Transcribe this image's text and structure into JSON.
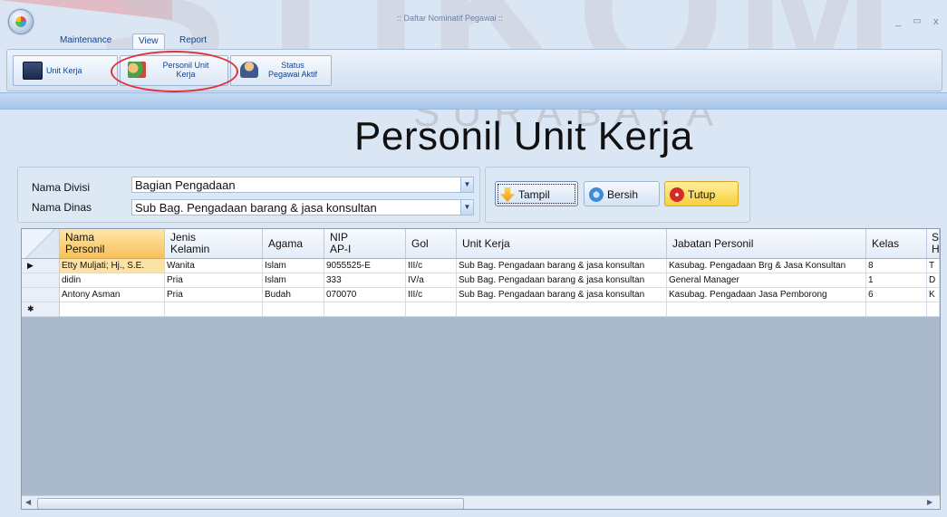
{
  "window": {
    "title": ":: Daftar Nominatif Pegawai ::",
    "minimize": "_",
    "maximize": "▭",
    "close": "x"
  },
  "watermark": {
    "main": "STIKOM",
    "sub": "SURABAYA"
  },
  "menu": {
    "tabs": [
      {
        "label": "Maintenance"
      },
      {
        "label": "View"
      },
      {
        "label": "Report"
      }
    ]
  },
  "ribbon": {
    "buttons": [
      {
        "label": "Unit Kerja",
        "icon": "monitor-icon"
      },
      {
        "label_line1": "Personil Unit",
        "label_line2": "Kerja",
        "icon": "people-group-icon"
      },
      {
        "label_line1": "Status",
        "label_line2": "Pegawai Aktif",
        "icon": "person-icon"
      }
    ]
  },
  "page": {
    "title": "Personil Unit Kerja"
  },
  "filters": {
    "divisi_label": "Nama Divisi",
    "divisi_value": "Bagian Pengadaan",
    "dinas_label": "Nama Dinas",
    "dinas_value": "Sub Bag. Pengadaan barang & jasa konsultan"
  },
  "actions": {
    "tampil": "Tampil",
    "bersih": "Bersih",
    "tutup": "Tutup"
  },
  "grid": {
    "headers": {
      "nama_line1": "Nama",
      "nama_line2": "Personil",
      "jk_line1": "Jenis",
      "jk_line2": "Kelamin",
      "agama": "Agama",
      "nip_line1": "NIP",
      "nip_line2": "AP-I",
      "gol": "Gol",
      "unit_kerja": "Unit Kerja",
      "jabatan": "Jabatan Personil",
      "kelas": "Kelas",
      "extra_line1": "S",
      "extra_line2": "H"
    },
    "rows": [
      {
        "marker": "▶",
        "nama": "Etty Muljati; Hj., S.E.",
        "jk": "Wanita",
        "agama": "Islam",
        "nip": "9055525-E",
        "gol": "III/c",
        "unit": "Sub Bag. Pengadaan barang & jasa konsultan",
        "jabatan": "Kasubag. Pengadaan Brg & Jasa Konsultan",
        "kelas": "8",
        "extra": "T"
      },
      {
        "marker": "",
        "nama": "didin",
        "jk": "Pria",
        "agama": "Islam",
        "nip": "333",
        "gol": "IV/a",
        "unit": "Sub Bag. Pengadaan barang & jasa konsultan",
        "jabatan": "General Manager",
        "kelas": "1",
        "extra": "D"
      },
      {
        "marker": "",
        "nama": "Antony Asman",
        "jk": "Pria",
        "agama": "Budah",
        "nip": "070070",
        "gol": "III/c",
        "unit": "Sub Bag. Pengadaan barang & jasa konsultan",
        "jabatan": "Kasubag. Pengadaan Jasa Pemborong",
        "kelas": "6",
        "extra": "K"
      }
    ],
    "new_row_marker": "✱"
  },
  "colors": {
    "accent": "#15428b",
    "selected_row": "#fbe3a7",
    "sorted_header": "#f7c05a",
    "highlight_circle": "#e0303a"
  }
}
